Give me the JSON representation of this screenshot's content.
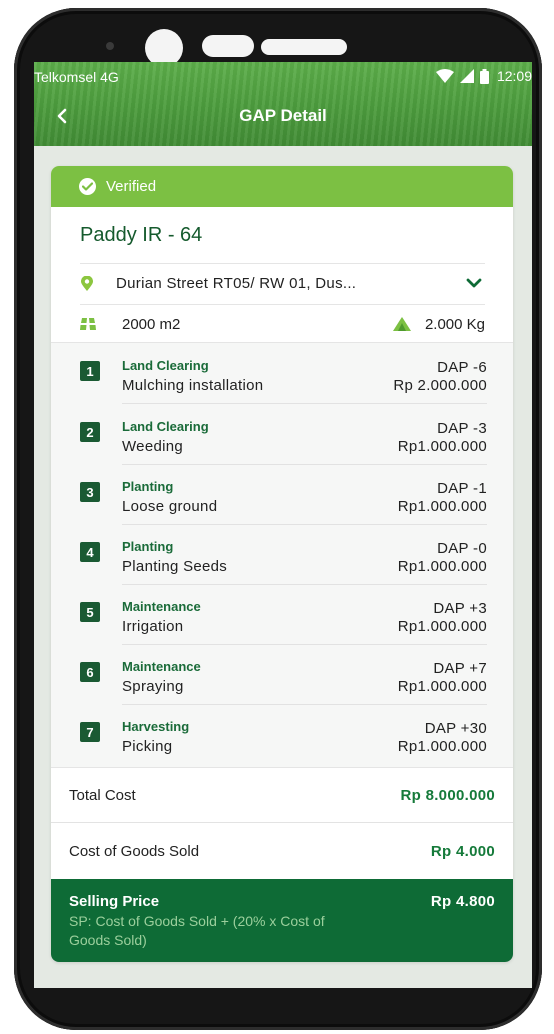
{
  "status_bar": {
    "carrier": "Telkomsel 4G",
    "time": "12:09"
  },
  "header": {
    "title": "GAP Detail"
  },
  "card": {
    "verified_label": "Verified",
    "crop_name": "Paddy IR - 64",
    "address": "Durian Street RT05/ RW 01, Dus...",
    "land_area": "2000 m2",
    "yield": "2.000 Kg"
  },
  "activities": [
    {
      "number": "1",
      "category": "Land Clearing",
      "task": "Mulching installation",
      "dap": "DAP -6",
      "cost": "Rp 2.000.000"
    },
    {
      "number": "2",
      "category": "Land Clearing",
      "task": "Weeding",
      "dap": "DAP -3",
      "cost": "Rp1.000.000"
    },
    {
      "number": "3",
      "category": "Planting",
      "task": "Loose ground",
      "dap": "DAP -1",
      "cost": "Rp1.000.000"
    },
    {
      "number": "4",
      "category": "Planting",
      "task": "Planting Seeds",
      "dap": "DAP -0",
      "cost": "Rp1.000.000"
    },
    {
      "number": "5",
      "category": "Maintenance",
      "task": "Irrigation",
      "dap": "DAP +3",
      "cost": "Rp1.000.000"
    },
    {
      "number": "6",
      "category": "Maintenance",
      "task": "Spraying",
      "dap": "DAP +7",
      "cost": "Rp1.000.000"
    },
    {
      "number": "7",
      "category": "Harvesting",
      "task": "Picking",
      "dap": "DAP +30",
      "cost": "Rp1.000.000"
    }
  ],
  "summary": {
    "total_cost_label": "Total Cost",
    "total_cost_value": "Rp 8.000.000",
    "cogs_label": "Cost of Goods Sold",
    "cogs_value": "Rp 4.000",
    "selling_price_label": "Selling Price",
    "selling_price_value": "Rp 4.800",
    "selling_price_formula": "SP: Cost of Goods Sold + (20% x Cost of Goods Sold)"
  },
  "colors": {
    "primary_dark": "#0e6b36",
    "verified_green": "#7cc043",
    "accent_text": "#157a3a"
  },
  "icons": {
    "back": "chevron-left-icon",
    "verified": "check-circle-icon",
    "location": "map-pin-icon",
    "expand": "chevron-down-icon",
    "area": "field-area-icon",
    "yield": "harvest-pile-icon"
  }
}
